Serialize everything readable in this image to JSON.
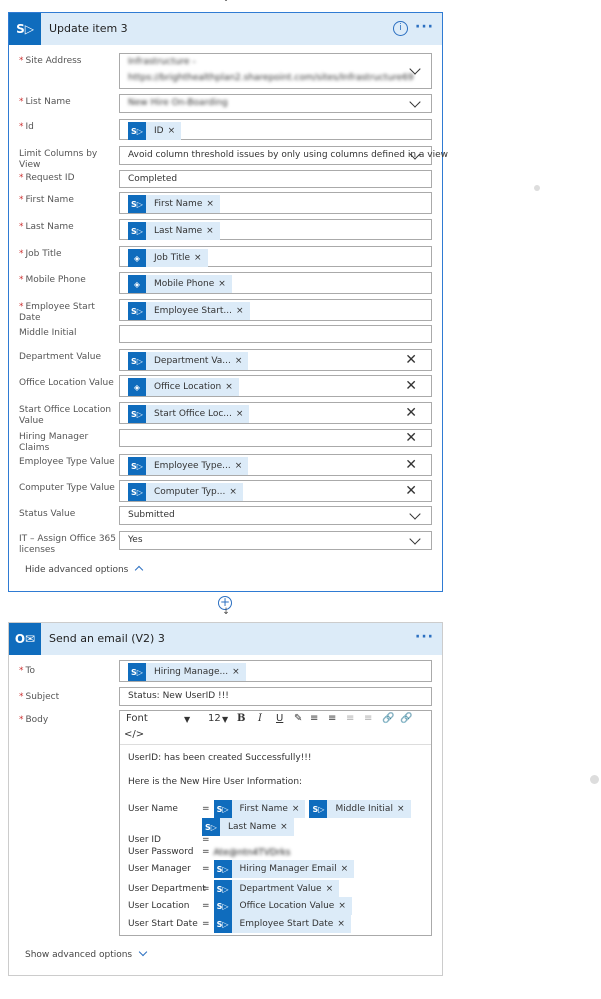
{
  "update_card": {
    "title": "Update item 3",
    "icon": "sharepoint-icon",
    "info_icon": "info-icon",
    "more_icon": "more-icon",
    "fields": [
      {
        "label": "Site Address",
        "required": true,
        "type": "select",
        "value_line1": "Infrastructure -",
        "value_line2": "https://brighthealthplan2.sharepoint.com/sites/Infrastructure69",
        "redacted": true
      },
      {
        "label": "List Name",
        "required": true,
        "type": "select",
        "value": "New Hire On-Boarding",
        "redacted": true
      },
      {
        "label": "Id",
        "required": true,
        "type": "token",
        "tokens": [
          {
            "label": "ID",
            "icon": "sharepoint-icon"
          }
        ]
      },
      {
        "label": "Limit Columns by View",
        "required": false,
        "type": "select",
        "value": "Avoid column threshold issues by only using columns defined in a view"
      },
      {
        "label": "Request ID",
        "required": true,
        "type": "text",
        "value": "Completed"
      },
      {
        "label": "First Name",
        "required": true,
        "type": "token",
        "tokens": [
          {
            "label": "First Name",
            "icon": "sharepoint-icon"
          }
        ]
      },
      {
        "label": "Last Name",
        "required": true,
        "type": "token",
        "tokens": [
          {
            "label": "Last Name",
            "icon": "sharepoint-icon"
          }
        ]
      },
      {
        "label": "Job Title",
        "required": true,
        "type": "token",
        "tokens": [
          {
            "label": "Job Title",
            "icon": "azure-ad-icon"
          }
        ]
      },
      {
        "label": "Mobile Phone",
        "required": true,
        "type": "token",
        "tokens": [
          {
            "label": "Mobile Phone",
            "icon": "azure-ad-icon"
          }
        ]
      },
      {
        "label": "Employee Start Date",
        "required": true,
        "type": "token",
        "tokens": [
          {
            "label": "Employee Start...",
            "icon": "sharepoint-icon"
          }
        ]
      },
      {
        "label": "Middle Initial",
        "required": false,
        "type": "text",
        "value": ""
      },
      {
        "label": "Department Value",
        "required": false,
        "type": "token",
        "clear": true,
        "tokens": [
          {
            "label": "Department Va...",
            "icon": "sharepoint-icon"
          }
        ]
      },
      {
        "label": "Office Location Value",
        "required": false,
        "type": "token",
        "clear": true,
        "tokens": [
          {
            "label": "Office Location",
            "icon": "azure-ad-icon"
          }
        ]
      },
      {
        "label": "Start Office Location Value",
        "required": false,
        "type": "token",
        "clear": true,
        "tokens": [
          {
            "label": "Start Office Loc...",
            "icon": "sharepoint-icon"
          }
        ]
      },
      {
        "label": "Hiring Manager Claims",
        "required": false,
        "type": "text",
        "clear": true,
        "value": ""
      },
      {
        "label": "Employee Type Value",
        "required": false,
        "type": "token",
        "clear": true,
        "tokens": [
          {
            "label": "Employee Type...",
            "icon": "sharepoint-icon"
          }
        ]
      },
      {
        "label": "Computer Type Value",
        "required": false,
        "type": "token",
        "clear": true,
        "tokens": [
          {
            "label": "Computer Typ...",
            "icon": "sharepoint-icon"
          }
        ]
      },
      {
        "label": "Status Value",
        "required": false,
        "type": "select",
        "value": "Submitted"
      },
      {
        "label": "IT – Assign Office 365 licenses",
        "required": false,
        "type": "select",
        "value": "Yes"
      }
    ],
    "advanced_toggle": "Hide advanced options"
  },
  "email_card": {
    "title": "Send an email (V2) 3",
    "icon": "outlook-icon",
    "more_icon": "more-icon",
    "to_label": "To",
    "to_tokens": [
      {
        "label": "Hiring Manage...",
        "icon": "sharepoint-icon"
      }
    ],
    "subject_label": "Subject",
    "subject_value": "Status: New UserID !!!",
    "body_label": "Body",
    "toolbar": {
      "font": "Font",
      "size": "12",
      "bold": "B",
      "italic": "I",
      "underline": "U",
      "code": "</>"
    },
    "body_lines": [
      {
        "text": "UserID: has been created Successfully!!!"
      },
      {
        "text": "Here is the New Hire User Information:"
      },
      {
        "text": "User Name",
        "sep": "=",
        "tokens": [
          {
            "label": "First Name"
          },
          {
            "label": "Middle Initial"
          }
        ]
      },
      {
        "text": "",
        "sep": "",
        "tokens": [
          {
            "label": "Last Name"
          }
        ]
      },
      {
        "text": "User ID",
        "sep": "="
      },
      {
        "text": "User Password",
        "sep": "=",
        "value": "Ate@ntn4TVDrks",
        "redacted": true
      },
      {
        "text": "User Manager",
        "sep": "=",
        "tokens": [
          {
            "label": "Hiring Manager Email"
          }
        ]
      },
      {
        "text": "User Department",
        "sep": "=",
        "tokens": [
          {
            "label": "Department Value"
          }
        ]
      },
      {
        "text": "User Location",
        "sep": "=",
        "tokens": [
          {
            "label": "Office Location Value"
          }
        ]
      },
      {
        "text": "User Start Date",
        "sep": "=",
        "tokens": [
          {
            "label": "Employee Start Date"
          }
        ]
      }
    ],
    "advanced_toggle": "Show advanced options"
  },
  "colors": {
    "accent": "#0f6cbd",
    "header_bg": "#dcebf8",
    "required": "#cc3333"
  }
}
